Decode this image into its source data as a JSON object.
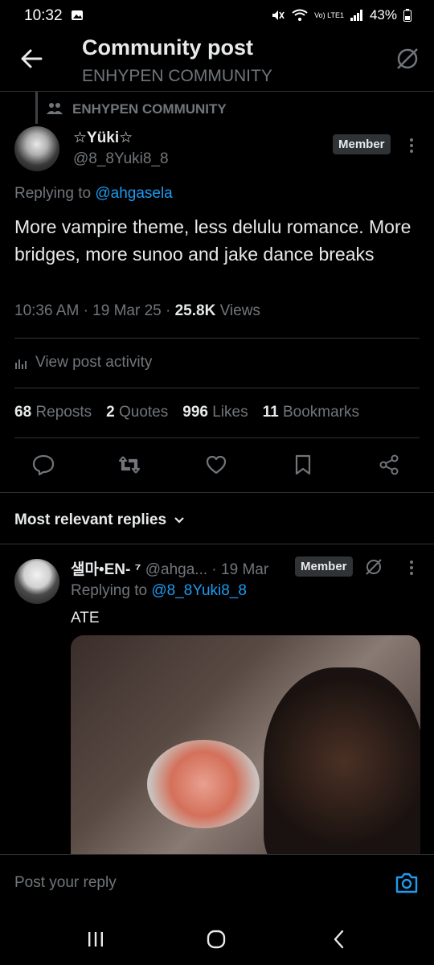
{
  "status": {
    "time": "10:32",
    "network": "Vo) LTE1",
    "battery": "43%"
  },
  "header": {
    "title": "Community post",
    "subtitle": "ENHYPEN COMMUNITY"
  },
  "community_label": "ENHYPEN COMMUNITY",
  "post": {
    "author_name": "☆Yüki☆",
    "author_handle": "@8_8Yuki8_8",
    "badge": "Member",
    "replying_prefix": "Replying to ",
    "replying_to": "@ahgasela",
    "text": "More vampire theme, less delulu romance. More bridges, more sunoo and jake dance breaks",
    "time": "10:36 AM",
    "date": "19 Mar 25",
    "views_count": "25.8K",
    "views_label": "Views",
    "activity_label": "View post activity",
    "stats": {
      "reposts_count": "68",
      "reposts_label": "Reposts",
      "quotes_count": "2",
      "quotes_label": "Quotes",
      "likes_count": "996",
      "likes_label": "Likes",
      "bookmarks_count": "11",
      "bookmarks_label": "Bookmarks"
    }
  },
  "replies": {
    "sort_label": "Most relevant replies",
    "items": [
      {
        "author_name": "샐마•EN- ⁷",
        "author_handle": "@ahga...",
        "date": "· 19 Mar",
        "badge": "Member",
        "replying_prefix": "Replying to ",
        "replying_to": "@8_8Yuki8_8",
        "text": "ATE"
      }
    ]
  },
  "compose": {
    "placeholder": "Post your reply"
  },
  "colors": {
    "accent": "#1d9bf0",
    "muted": "#71767b",
    "background": "#000000",
    "divider": "#2f3336"
  }
}
